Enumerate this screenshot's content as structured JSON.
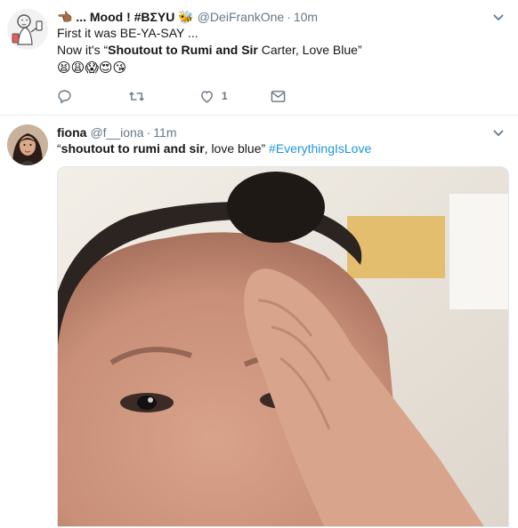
{
  "tweets": [
    {
      "name": "👈🏾 ... Mood ! #BΣYU 🐝",
      "handle": "@DeiFrankOne",
      "separator": "·",
      "time": "10m",
      "line1": "First it was BE-YA-SAY ...",
      "line2_prefix": "Now it's “",
      "line2_bold": "Shoutout to Rumi and Sir",
      "line2_suffix": " Carter, Love Blue”",
      "emojis": "😫😩😱😍😘",
      "actions": {
        "reply_icon": "reply-icon",
        "retweet_icon": "retweet-icon",
        "like_icon": "heart-icon",
        "like_count": "1",
        "dm_icon": "envelope-icon"
      },
      "avatar": "cartoon-avatar",
      "menu_icon": "chevron-down-icon"
    },
    {
      "name": "fiona",
      "handle": "@f__iona",
      "separator": "·",
      "time": "11m",
      "text_prefix": "“",
      "text_bold": "shoutout to rumi and sir",
      "text_suffix": ", love blue” ",
      "hashtag": "#EverythingIsLove",
      "avatar": "profile-photo",
      "menu_icon": "chevron-down-icon",
      "media": "selfie-photo"
    }
  ],
  "colors": {
    "link": "#1b95e0",
    "secondary": "#657786",
    "text": "#14171a",
    "border": "#e6ecf0"
  }
}
